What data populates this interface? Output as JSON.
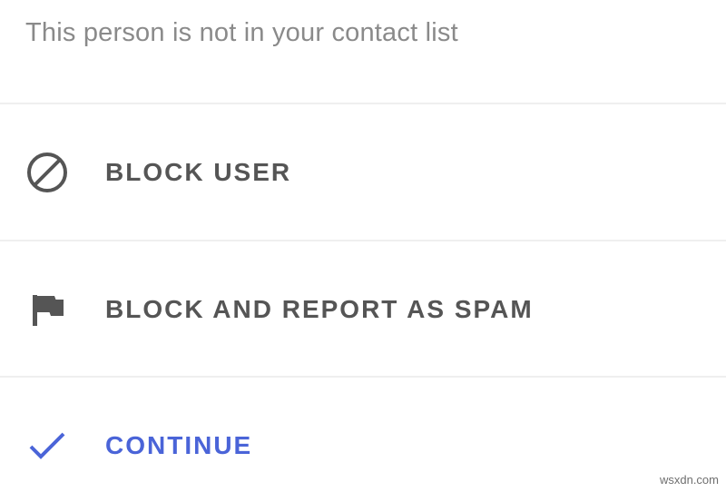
{
  "dialog": {
    "notice": "This person is not in your contact list",
    "actions": [
      {
        "label": "BLOCK USER",
        "icon": "block-icon",
        "color": "#555555"
      },
      {
        "label": "BLOCK AND REPORT AS SPAM",
        "icon": "flag-icon",
        "color": "#555555"
      },
      {
        "label": "CONTINUE",
        "icon": "check-icon",
        "color": "#4a64d8"
      }
    ]
  },
  "watermark": "wsxdn.com",
  "colors": {
    "background": "#ffffff",
    "divider": "#efefef",
    "notice_text": "#8a8a8a",
    "action_text": "#555555",
    "accent": "#4a64d8"
  }
}
